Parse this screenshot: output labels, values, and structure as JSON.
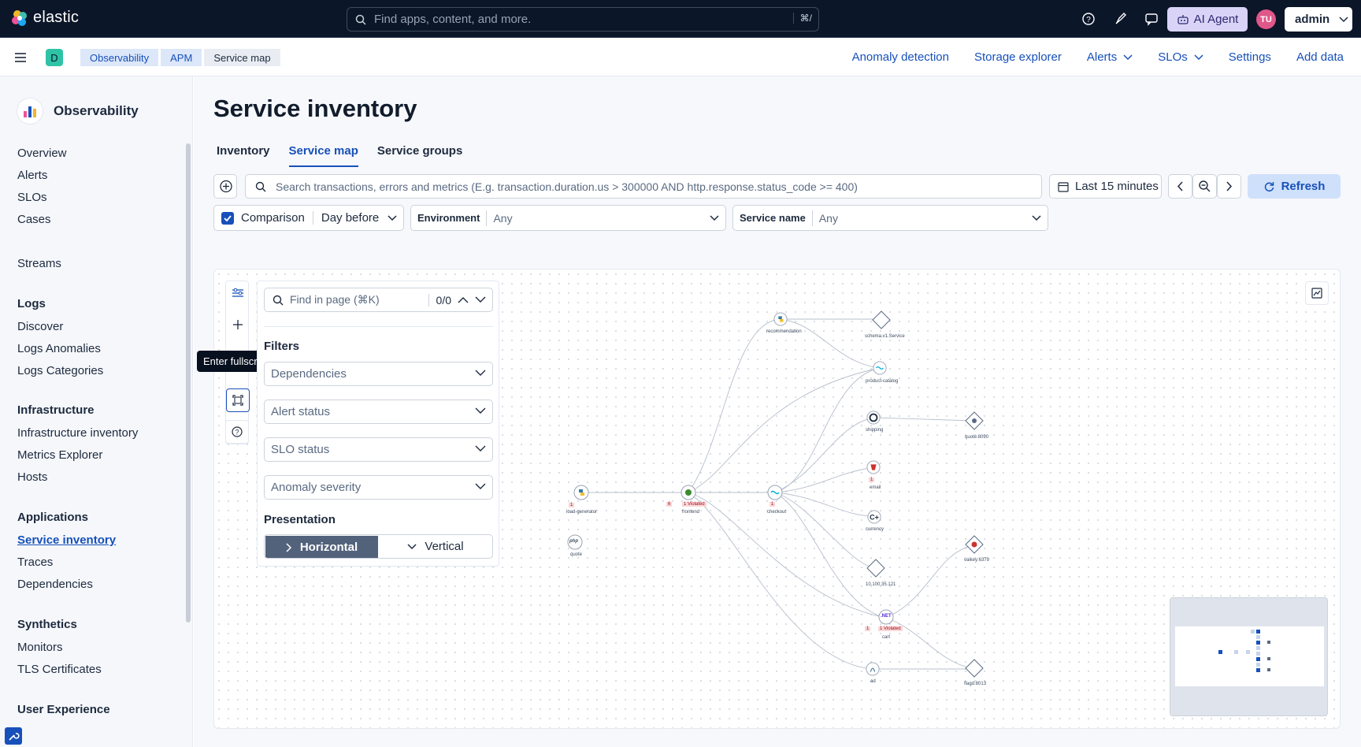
{
  "header": {
    "brand": "elastic",
    "search_placeholder": "Find apps, content, and more.",
    "search_shortcut": "⌘/",
    "ai_agent_label": "AI Agent",
    "avatar_initials": "TU",
    "user_label": "admin"
  },
  "breadcrumbs": {
    "space_initial": "D",
    "items": [
      "Observability",
      "APM",
      "Service map"
    ]
  },
  "top_nav": {
    "items": [
      "Anomaly detection",
      "Storage explorer",
      "Alerts",
      "SLOs",
      "Settings",
      "Add data"
    ]
  },
  "sidebar": {
    "title": "Observability",
    "items": {
      "overview": "Overview",
      "alerts": "Alerts",
      "slos": "SLOs",
      "cases": "Cases",
      "streams": "Streams",
      "logs": "Logs",
      "discover": "Discover",
      "logs_anomalies": "Logs Anomalies",
      "logs_categories": "Logs Categories",
      "infrastructure": "Infrastructure",
      "infra_inventory": "Infrastructure inventory",
      "metrics_explorer": "Metrics Explorer",
      "hosts": "Hosts",
      "applications": "Applications",
      "service_inventory": "Service inventory",
      "traces": "Traces",
      "dependencies": "Dependencies",
      "synthetics": "Synthetics",
      "monitors": "Monitors",
      "tls_certificates": "TLS Certificates",
      "user_experience": "User Experience"
    }
  },
  "page": {
    "title": "Service inventory",
    "tabs": [
      "Inventory",
      "Service map",
      "Service groups"
    ],
    "query_placeholder": "Search transactions, errors and metrics (E.g. transaction.duration.us > 300000 AND http.response.status_code >= 400)",
    "time_range": "Last 15 minutes",
    "refresh_label": "Refresh",
    "comparison_label": "Comparison",
    "comparison_value": "Day before",
    "environment_label": "Environment",
    "environment_value": "Any",
    "service_name_label": "Service name",
    "service_name_value": "Any"
  },
  "map": {
    "tooltip": "Enter fullscreen",
    "find_placeholder": "Find in page (⌘K)",
    "find_count": "0/0",
    "filters_heading": "Filters",
    "filters": [
      "Dependencies",
      "Alert status",
      "SLO status",
      "Anomaly severity"
    ],
    "presentation_heading": "Presentation",
    "horizontal_label": "Horizontal",
    "vertical_label": "Vertical",
    "node_labels": {
      "load_generator": "load-generator",
      "quote": "quote",
      "frontend": "frontend",
      "checkout": "checkout",
      "recommendation": "recommendation",
      "schema_service": "schema.v1.Service",
      "product_catalog": "product-catalog",
      "shipping": "shipping",
      "quote_dep": "quote:8090",
      "email": "email",
      "currency": "currency",
      "ip_dep": "10.100.35.121",
      "valkey": "valkey:6379",
      "cart": "cart",
      "ad": "ad",
      "flagd": "flagd:8013"
    },
    "badges": {
      "load_generator": "1",
      "frontend_alerts": "6",
      "frontend_slo": "1 Violated",
      "checkout": "1",
      "email": "1",
      "cart_alerts": "1",
      "cart_slo": "1 Violated"
    },
    "icon_text": {
      "quote": "php",
      "cart": ".NET"
    }
  },
  "colors": {
    "header_bg": "#0b1628",
    "accent": "#1750ba",
    "ai_agent_bg": "#d9d3f7",
    "refresh_bg": "#cfe0fb",
    "badge_red": "#f8d7d7"
  }
}
